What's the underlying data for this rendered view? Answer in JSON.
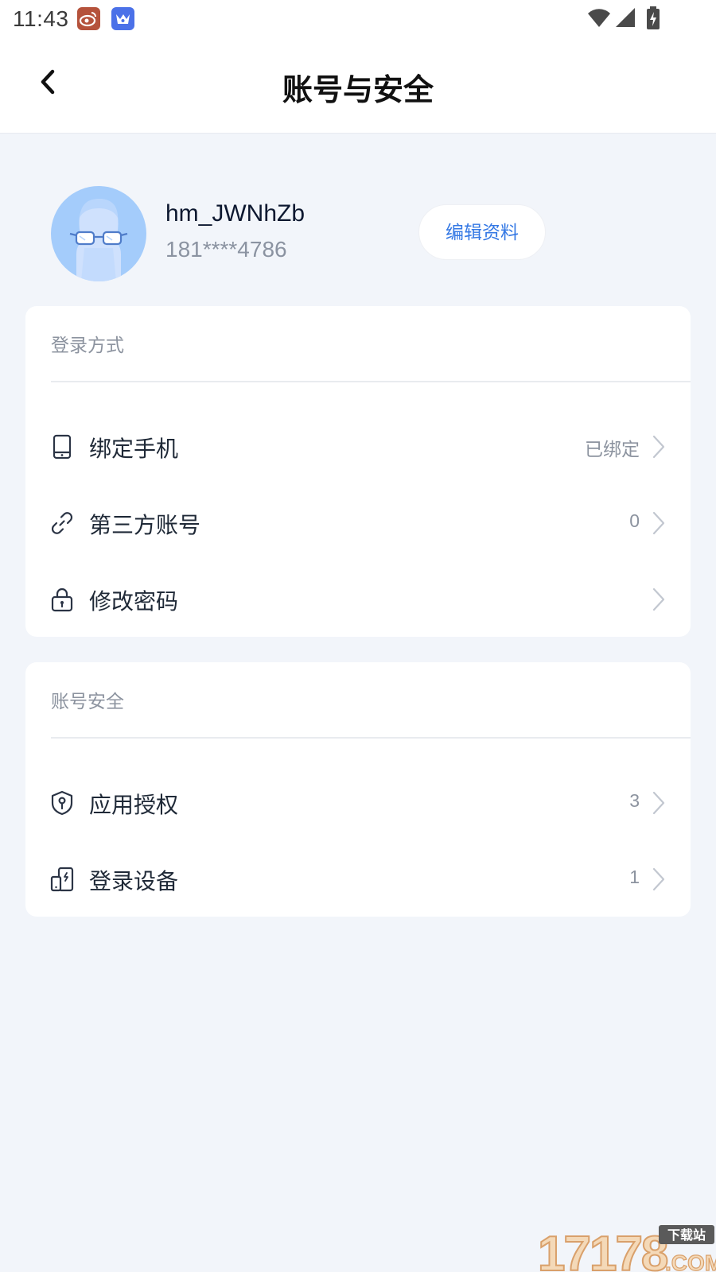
{
  "status_bar": {
    "time": "11:43",
    "icons": [
      "weibo-app-icon",
      "bird-app-icon",
      "wifi-icon",
      "cell-signal-icon",
      "battery-charging-icon"
    ]
  },
  "nav": {
    "title": "账号与安全",
    "back_icon": "chevron-left-icon"
  },
  "profile": {
    "username": "hm_JWNhZb",
    "phone": "181****4786",
    "edit_label": "编辑资料",
    "avatar_icon": "avatar-glasses-icon"
  },
  "login_section": {
    "header": "登录方式",
    "items": [
      {
        "label": "绑定手机",
        "value": "已绑定",
        "icon": "phone-icon"
      },
      {
        "label": "第三方账号",
        "value": "0",
        "icon": "link-icon"
      },
      {
        "label": "修改密码",
        "value": "",
        "icon": "lock-icon"
      }
    ]
  },
  "security_section": {
    "header": "账号安全",
    "items": [
      {
        "label": "应用授权",
        "value": "3",
        "icon": "shield-key-icon"
      },
      {
        "label": "登录设备",
        "value": "1",
        "icon": "devices-icon"
      }
    ]
  },
  "colors": {
    "background": "#f2f5fa",
    "accent": "#3478e4",
    "avatar_bg": "#a4ccfb",
    "secondary_text": "#8c939f"
  },
  "watermark": {
    "text": "17178",
    "suffix": ".COM",
    "badge": "下载站"
  }
}
